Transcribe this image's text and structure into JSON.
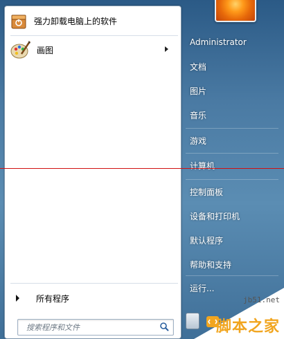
{
  "left_pane": {
    "pinned": [
      {
        "label": "强力卸载电脑上的软件",
        "icon": "uninstall-box-icon"
      },
      {
        "label": "画图",
        "icon": "paint-palette-icon",
        "has_submenu": true
      }
    ],
    "all_programs_label": "所有程序",
    "search": {
      "placeholder": "搜索程序和文件"
    }
  },
  "right_pane": {
    "items": [
      {
        "label": "Administrator"
      },
      {
        "label": "文档"
      },
      {
        "label": "图片"
      },
      {
        "label": "音乐"
      },
      {
        "label": "游戏"
      },
      {
        "label": "计算机"
      },
      {
        "label": "控制面板"
      },
      {
        "label": "设备和打印机"
      },
      {
        "label": "默认程序"
      },
      {
        "label": "帮助和支持"
      },
      {
        "label": "运行..."
      }
    ]
  },
  "watermark": {
    "url": "jb51.net",
    "name": "脚本之家"
  },
  "colors": {
    "accent_line": "#d01010",
    "watermark_orange": "#f1a51f",
    "menu_blue": "#4a7aa3"
  }
}
